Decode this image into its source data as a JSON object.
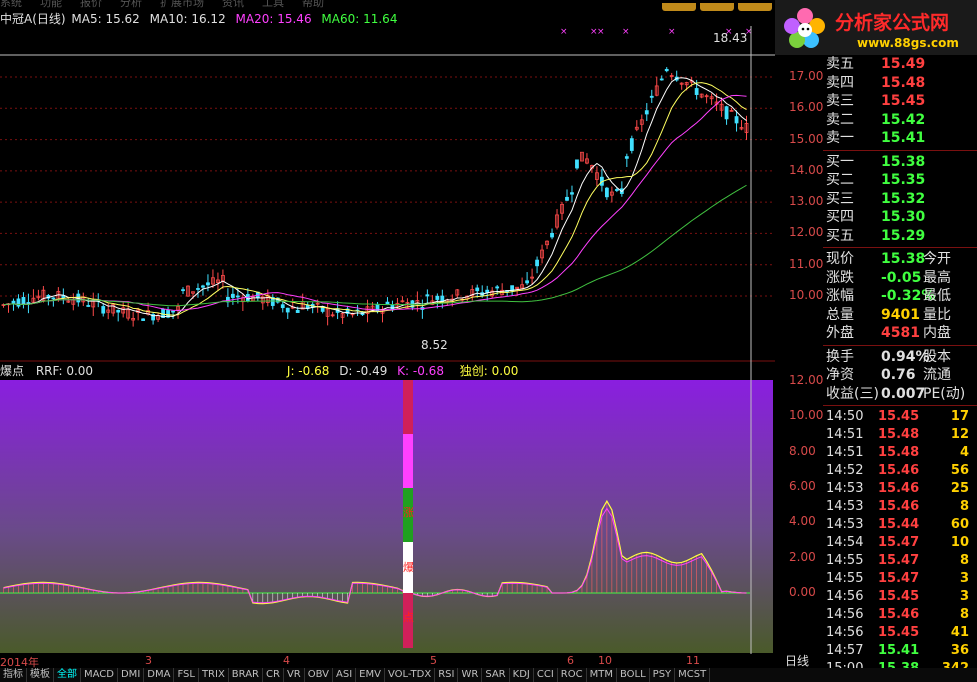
{
  "menu": [
    "系统",
    "功能",
    "报价",
    "分析",
    "扩展市场",
    "资讯",
    "工具",
    "帮助"
  ],
  "header": {
    "stock": "中冠A(日线)",
    "ma5": "MA5: 15.62",
    "ma10": "MA10: 16.12",
    "ma20": "MA20: 15.46",
    "ma60": "MA60: 11.64"
  },
  "logo": {
    "site": "分析家公式网",
    "url": "www.88gs.com"
  },
  "price_axis": [
    "17.00",
    "16.00",
    "15.00",
    "14.00",
    "13.00",
    "12.00",
    "11.00",
    "10.00"
  ],
  "price_labels": {
    "high": "18.43",
    "low": "8.52"
  },
  "indicator_header": {
    "name": "爆点",
    "rrf": "RRF: 0.00",
    "j": "J: -0.68",
    "d": "D: -0.49",
    "k": "K: -0.68",
    "dc": "独创: 0.00"
  },
  "indicator_axis": [
    "12.00",
    "10.00",
    "8.00",
    "6.00",
    "4.00",
    "2.00",
    "0.00"
  ],
  "indicator_marker_text": [
    "涨",
    "爆",
    "点"
  ],
  "date_axis": [
    "2014年",
    "3",
    "4",
    "5",
    "6",
    "10",
    "11"
  ],
  "period_label": "日线",
  "quote": {
    "asks": [
      {
        "label": "卖五",
        "price": "15.49",
        "color": "#ff4040"
      },
      {
        "label": "卖四",
        "price": "15.48",
        "color": "#ff4040"
      },
      {
        "label": "卖三",
        "price": "15.45",
        "color": "#ff4040"
      },
      {
        "label": "卖二",
        "price": "15.42",
        "color": "#40ff40"
      },
      {
        "label": "卖一",
        "price": "15.41",
        "color": "#40ff40"
      }
    ],
    "bids": [
      {
        "label": "买一",
        "price": "15.38",
        "color": "#40ff40"
      },
      {
        "label": "买二",
        "price": "15.35",
        "color": "#40ff40"
      },
      {
        "label": "买三",
        "price": "15.32",
        "color": "#40ff40"
      },
      {
        "label": "买四",
        "price": "15.30",
        "color": "#40ff40"
      },
      {
        "label": "买五",
        "price": "15.29",
        "color": "#40ff40"
      }
    ],
    "stats": [
      {
        "label": "现价",
        "value": "15.38",
        "color": "#40ff40",
        "label2": "今开"
      },
      {
        "label": "涨跌",
        "value": "-0.05",
        "color": "#40ff40",
        "label2": "最高"
      },
      {
        "label": "涨幅",
        "value": "-0.32%",
        "color": "#40ff40",
        "label2": "最低"
      },
      {
        "label": "总量",
        "value": "9401",
        "color": "#ffd000",
        "label2": "量比"
      },
      {
        "label": "外盘",
        "value": "4581",
        "color": "#ff4040",
        "label2": "内盘"
      }
    ],
    "stats2": [
      {
        "label": "换手",
        "value": "0.94%",
        "color": "#e0e0e0",
        "label2": "股本"
      },
      {
        "label": "净资",
        "value": "0.76",
        "color": "#e0e0e0",
        "label2": "流通"
      },
      {
        "label": "收益(三)",
        "value": "0.007",
        "color": "#e0e0e0",
        "label2": "PE(动)"
      }
    ]
  },
  "ticks": [
    {
      "time": "14:50",
      "price": "15.45",
      "vol": "17",
      "color": "#ff4040"
    },
    {
      "time": "14:51",
      "price": "15.48",
      "vol": "12",
      "color": "#ff4040"
    },
    {
      "time": "14:51",
      "price": "15.48",
      "vol": "4",
      "color": "#ff4040"
    },
    {
      "time": "14:52",
      "price": "15.46",
      "vol": "56",
      "color": "#ff4040"
    },
    {
      "time": "14:53",
      "price": "15.46",
      "vol": "25",
      "color": "#ff4040"
    },
    {
      "time": "14:53",
      "price": "15.46",
      "vol": "8",
      "color": "#ff4040"
    },
    {
      "time": "14:53",
      "price": "15.44",
      "vol": "60",
      "color": "#ff4040"
    },
    {
      "time": "14:54",
      "price": "15.47",
      "vol": "10",
      "color": "#ff4040"
    },
    {
      "time": "14:55",
      "price": "15.47",
      "vol": "8",
      "color": "#ff4040"
    },
    {
      "time": "14:55",
      "price": "15.47",
      "vol": "3",
      "color": "#ff4040"
    },
    {
      "time": "14:56",
      "price": "15.45",
      "vol": "3",
      "color": "#ff4040"
    },
    {
      "time": "14:56",
      "price": "15.46",
      "vol": "8",
      "color": "#ff4040"
    },
    {
      "time": "14:56",
      "price": "15.45",
      "vol": "41",
      "color": "#ff4040"
    },
    {
      "time": "14:57",
      "price": "15.41",
      "vol": "36",
      "color": "#40ff40"
    },
    {
      "time": "15:00",
      "price": "15.38",
      "vol": "342",
      "color": "#40ff40"
    }
  ],
  "tabs": [
    "指标",
    "模板",
    "全部",
    "MACD",
    "DMI",
    "DMA",
    "FSL",
    "TRIX",
    "BRAR",
    "CR",
    "VR",
    "OBV",
    "ASI",
    "EMV",
    "VOL-TDX",
    "RSI",
    "WR",
    "SAR",
    "KDJ",
    "CCI",
    "ROC",
    "MTM",
    "BOLL",
    "PSY",
    "MCST"
  ],
  "active_tab": "全部"
}
